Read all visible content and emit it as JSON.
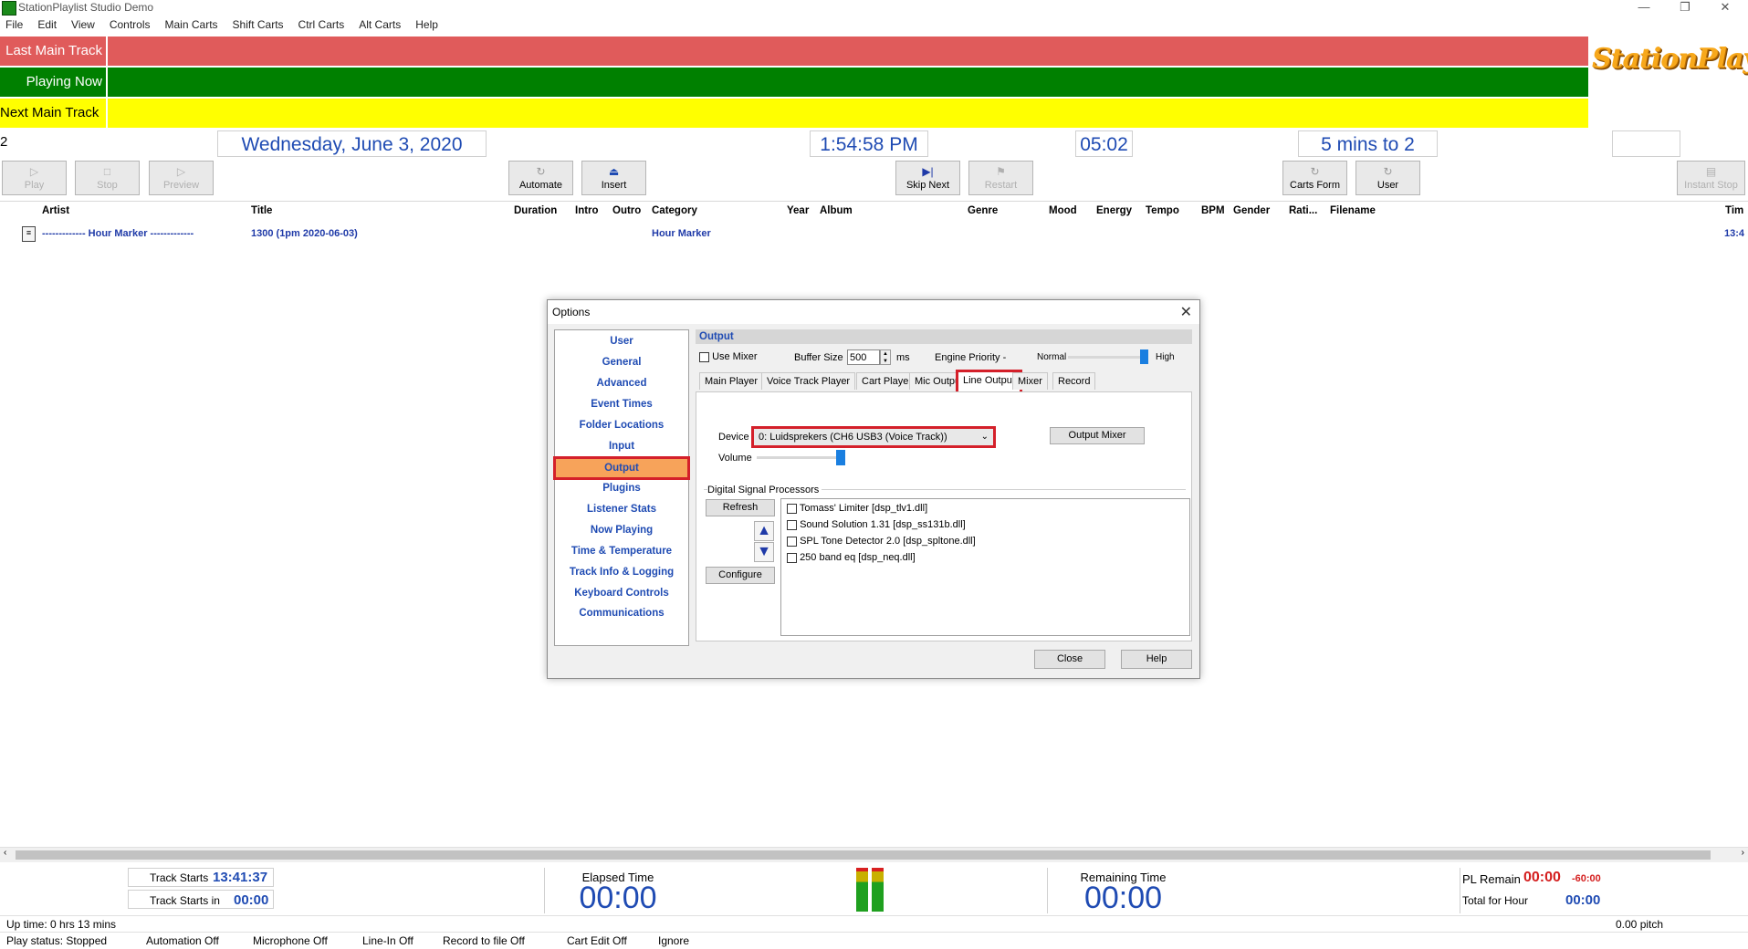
{
  "window": {
    "title": "StationPlaylist Studio Demo",
    "controls": [
      "—",
      "❐",
      "✕"
    ]
  },
  "menu": [
    "File",
    "Edit",
    "View",
    "Controls",
    "Main Carts",
    "Shift Carts",
    "Ctrl Carts",
    "Alt Carts",
    "Help"
  ],
  "rows": {
    "last_main_track": {
      "label": "Last Main Track",
      "color": "#e05b5b"
    },
    "playing_now": {
      "label": "Playing Now",
      "color": "#008000"
    },
    "next_main_track": {
      "label": "Next Main Track 2",
      "color": "#ffff00"
    }
  },
  "logo_text": "StationPlaylist",
  "info": {
    "date": "Wednesday, June 3, 2020",
    "time": "1:54:58 PM",
    "countdown": "05:02",
    "to_hour": "5 mins to 2",
    "extra": ""
  },
  "toolbar": {
    "play": "Play",
    "stop": "Stop",
    "preview": "Preview",
    "automate": "Automate",
    "insert": "Insert",
    "skip_next": "Skip Next",
    "restart": "Restart",
    "carts_form": "Carts Form",
    "user": "User",
    "instant_stop": "Instant Stop"
  },
  "columns": [
    "Artist",
    "Title",
    "Duration",
    "Intro",
    "Outro",
    "Category",
    "Year",
    "Album",
    "Genre",
    "Mood",
    "Energy",
    "Tempo",
    "BPM",
    "Gender",
    "Rati...",
    "Filename",
    "Tim"
  ],
  "track": {
    "artist": "------------- Hour Marker -------------",
    "title": "1300 (1pm 2020-06-03)",
    "category": "Hour Marker",
    "time": "13:4"
  },
  "dialog": {
    "title": "Options",
    "nav": [
      "User",
      "General",
      "Advanced",
      "Event Times",
      "Folder Locations",
      "Input",
      "Output",
      "Plugins",
      "Listener Stats",
      "Now Playing",
      "Time & Temperature",
      "Track Info & Logging",
      "Keyboard Controls",
      "Communications"
    ],
    "selected_nav": "Output",
    "panel_title": "Output",
    "use_mixer": "Use Mixer",
    "buffer_size_label": "Buffer Size",
    "buffer_size_value": "500",
    "ms": "ms",
    "engine_priority": "Engine Priority -",
    "normal": "Normal",
    "high": "High",
    "engine_priority_level": 1.0,
    "tabs": [
      "Main Player",
      "Voice Track Player",
      "Cart Player",
      "Mic Output",
      "Line Output",
      "Mixer",
      "Record"
    ],
    "active_tab": "Line Output",
    "device_label": "Device",
    "device_value": "0: Luidsprekers (CH6 USB3 (Voice Track))",
    "output_mixer": "Output Mixer",
    "volume_label": "Volume",
    "volume_level": 1.0,
    "dsp_title": "Digital Signal Processors",
    "refresh": "Refresh",
    "configure": "Configure",
    "dsp_items": [
      "Tomass' Limiter [dsp_tlv1.dll]",
      "Sound Solution 1.31 [dsp_ss131b.dll]",
      "SPL Tone Detector 2.0 [dsp_spltone.dll]",
      "250 band eq [dsp_neq.dll]"
    ],
    "close": "Close",
    "help": "Help"
  },
  "bottom": {
    "track_starts_label": "Track Starts",
    "track_starts_value": "13:41:37",
    "track_starts_in_label": "Track Starts in",
    "track_starts_in_value": "00:00",
    "elapsed_label": "Elapsed Time",
    "elapsed_value": "00:00",
    "remaining_label": "Remaining Time",
    "remaining_value": "00:00",
    "pl_remain_label": "PL Remain",
    "pl_remain_value": "00:00",
    "pl_remain_neg": "-60:00",
    "total_hour_label": "Total for Hour",
    "total_hour_value": "00:00",
    "pitch": "0.00 pitch"
  },
  "status": {
    "uptime": "Up time: 0 hrs 13 mins",
    "play_status": "Play status: Stopped",
    "automation": "Automation Off",
    "microphone": "Microphone Off",
    "line_in": "Line-In Off",
    "record": "Record to file Off",
    "cart_edit": "Cart Edit Off",
    "ignore": "Ignore"
  }
}
